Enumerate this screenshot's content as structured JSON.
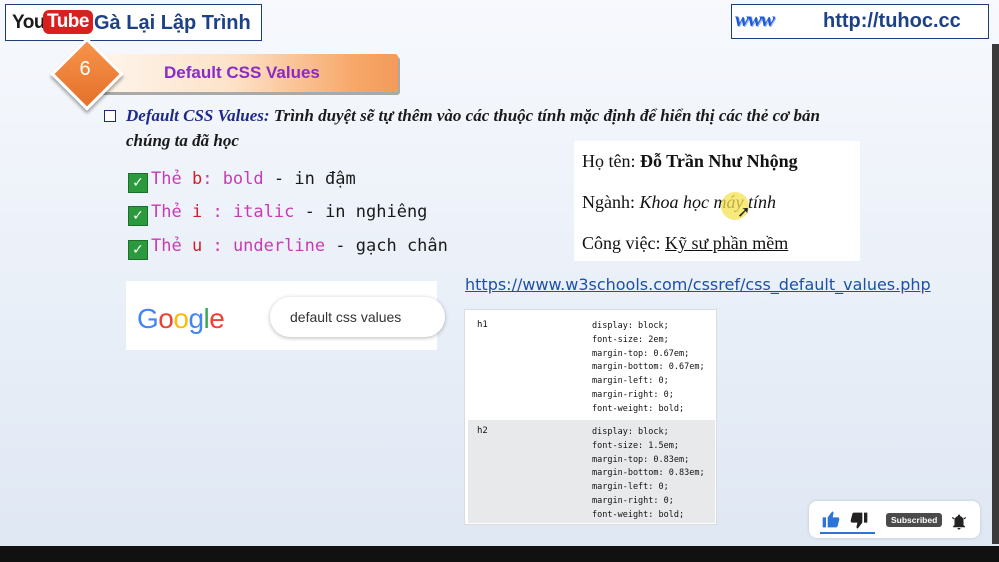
{
  "header": {
    "youtube_you": "You",
    "youtube_tube": "Tube",
    "channel_name": "Gà Lại Lập Trình",
    "www_logo": "www",
    "website": "http://tuhoc.cc"
  },
  "section": {
    "number": "6",
    "title": "Default CSS Values"
  },
  "paragraph": {
    "emphasis": "Default CSS Values:",
    "text_line1": " Trình duyệt sẽ tự thêm vào các thuộc tính mặc định để hiển thị các thẻ cơ bản",
    "text_line2": "chúng ta đã học"
  },
  "tag_items": [
    {
      "the": "Thẻ",
      "letter": "b",
      "prop": ": bold",
      "desc": " - in đậm"
    },
    {
      "the": "Thẻ",
      "letter": "i",
      "prop": ": italic",
      "desc": " - in nghiêng"
    },
    {
      "the": "Thẻ",
      "letter": "u",
      "prop": ": underline",
      "desc": " - gạch chân"
    }
  ],
  "example": {
    "name_label": "Họ tên: ",
    "name_value": "Đỗ Trần Như Nhộng",
    "major_label": "Ngành: ",
    "major_value": "Khoa học máy tính",
    "job_label": "Công việc: ",
    "job_value": "Kỹ sư phần mềm"
  },
  "reference_link": "https://www.w3schools.com/cssref/css_default_values.php",
  "google": {
    "logo_letters": [
      "G",
      "o",
      "o",
      "g",
      "l",
      "e"
    ],
    "logo_colors": [
      "#4285f4",
      "#ea4335",
      "#fbbc05",
      "#4285f4",
      "#34a853",
      "#ea4335"
    ],
    "query": "default css values"
  },
  "css_defaults": [
    {
      "tag": "h1",
      "declarations": [
        "display: block;",
        "font-size: 2em;",
        "margin-top: 0.67em;",
        "margin-bottom: 0.67em;",
        "margin-left: 0;",
        "margin-right: 0;",
        "font-weight: bold;"
      ]
    },
    {
      "tag": "h2",
      "declarations": [
        "display: block;",
        "font-size: 1.5em;",
        "margin-top: 0.83em;",
        "margin-bottom: 0.83em;",
        "margin-left: 0;",
        "margin-right: 0;",
        "font-weight: bold;"
      ]
    }
  ],
  "player": {
    "subscribed": "Subscribed"
  },
  "icons": {
    "like": "thumbs-up-icon",
    "dislike": "thumbs-down-icon",
    "bell": "bell-icon",
    "check": "checkmark-icon"
  }
}
